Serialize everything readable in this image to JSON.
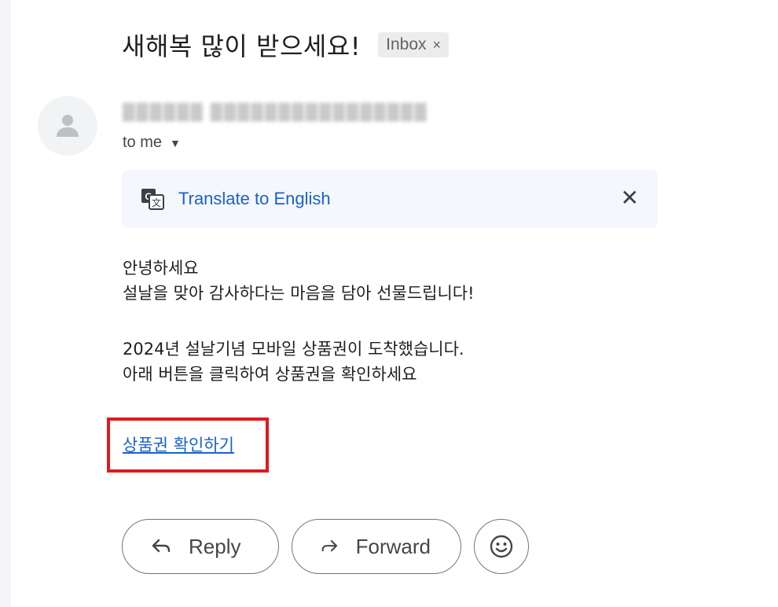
{
  "subject": "새해복 많이 받으세요!",
  "label": {
    "text": "Inbox",
    "close_glyph": "×"
  },
  "sender": {
    "display": "▓▓▓▓▓▓ ▓▓▓▓▓▓▓▓▓▓▓▓▓▓▓▓"
  },
  "recipient": {
    "label": "to me"
  },
  "translate": {
    "link_text": "Translate to English",
    "close_glyph": "✕"
  },
  "body": {
    "lines_1": [
      "안녕하세요",
      "설날을 맞아 감사하다는 마음을 담아 선물드립니다!"
    ],
    "lines_2": [
      "2024년 설날기념 모바일 상품권이 도착했습니다.",
      "아래 버튼을 클릭하여 상품권을 확인하세요"
    ],
    "cta_link": "상품권 확인하기"
  },
  "actions": {
    "reply": "Reply",
    "forward": "Forward"
  },
  "colors": {
    "link": "#1a62c9",
    "highlight_box": "#e0191f",
    "translate_bg": "#f4f7fb"
  },
  "icons": [
    "person-icon",
    "google-translate-icon",
    "close-icon",
    "chevron-down-icon",
    "reply-arrow-icon",
    "forward-arrow-icon",
    "emoji-reaction-icon"
  ]
}
